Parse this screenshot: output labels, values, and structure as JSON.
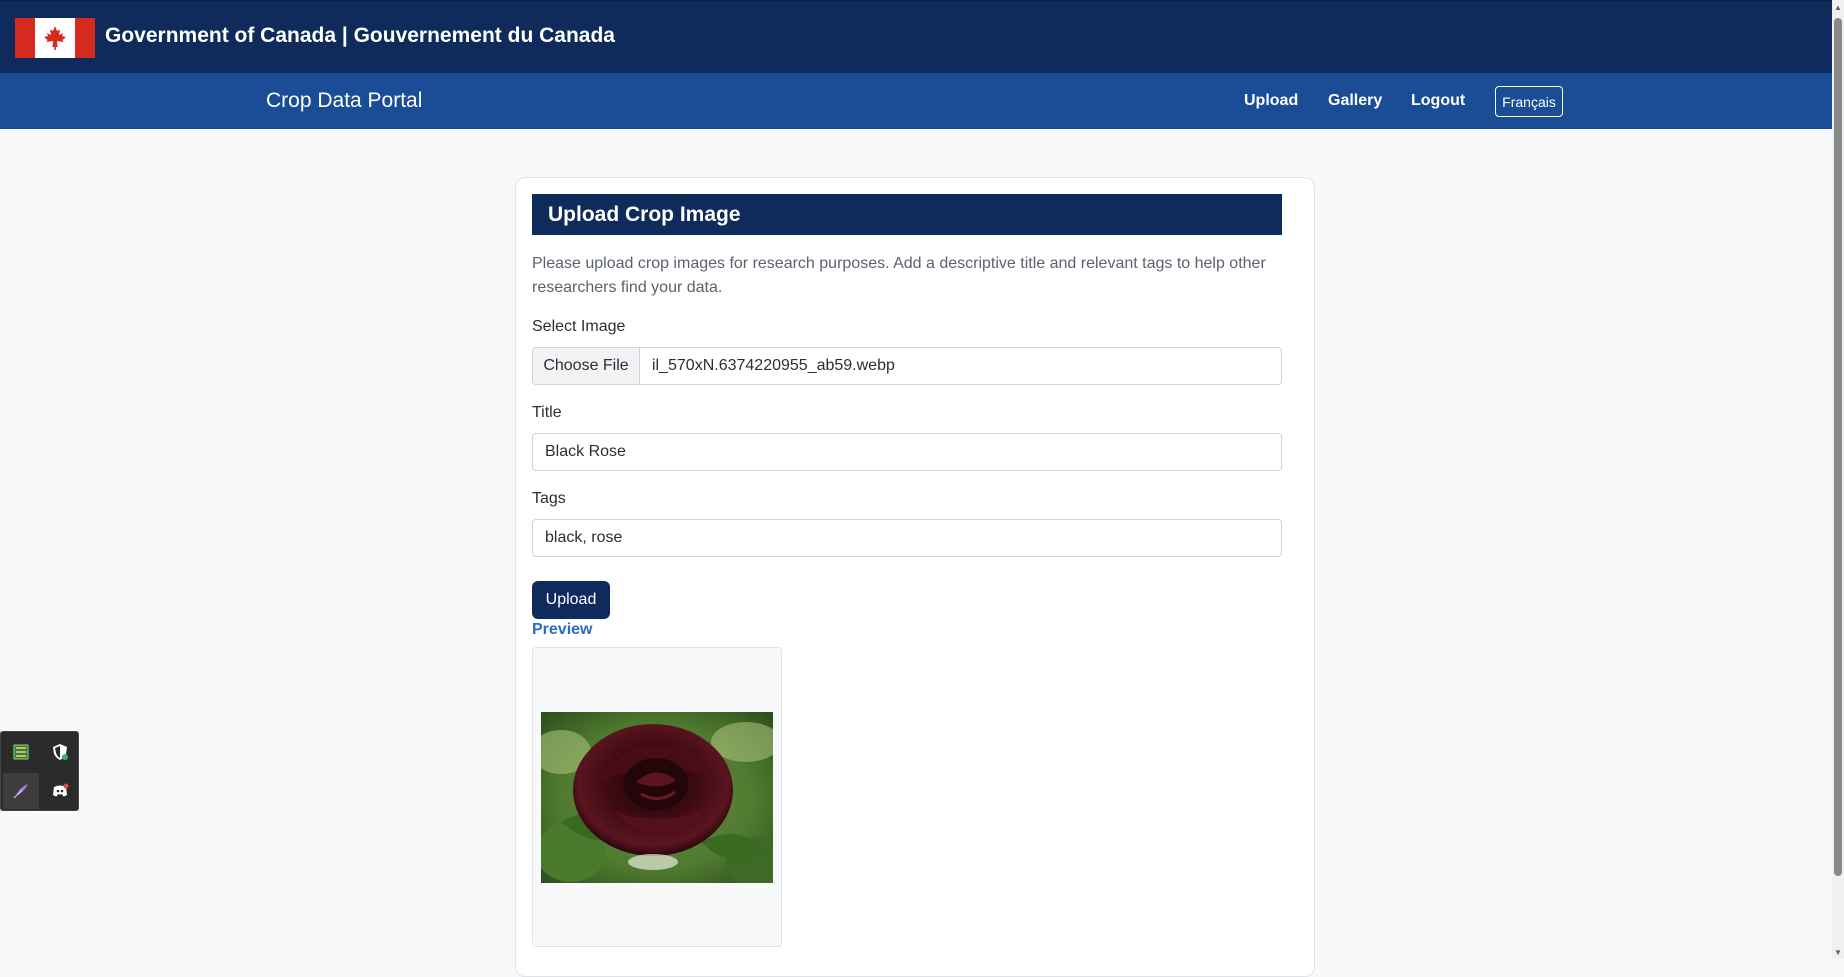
{
  "gov_header": {
    "title": "Government of Canada | Gouvernement du Canada",
    "flag_icon": "canada-flag-icon"
  },
  "nav": {
    "brand": "Crop Data Portal",
    "links": [
      "Upload",
      "Gallery",
      "Logout"
    ],
    "language_button": "Français"
  },
  "form": {
    "heading": "Upload Crop Image",
    "intro": "Please upload crop images for research purposes. Add a descriptive title and relevant tags to help other researchers find your data.",
    "image_label": "Select Image",
    "file_button": "Choose File",
    "file_name": "il_570xN.6374220955_ab59.webp",
    "title_label": "Title",
    "title_value": "Black Rose",
    "tags_label": "Tags",
    "tags_value": "black, rose",
    "submit_label": "Upload",
    "preview_label": "Preview"
  },
  "colors": {
    "gov_header_bg": "#0f2b5c",
    "nav_bg": "#1a4d96",
    "accent": "#0f2b5c",
    "preview_link": "#2c6bc4"
  },
  "tray": {
    "icons": [
      "app-grid-icon",
      "shield-icon",
      "feather-icon",
      "discord-icon"
    ]
  }
}
